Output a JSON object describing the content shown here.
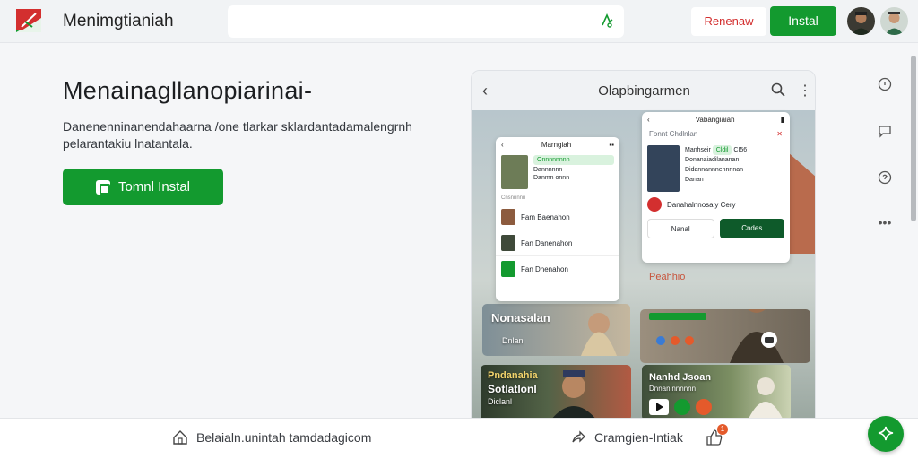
{
  "header": {
    "brand": "Menimgtianiah",
    "search_placeholder": "",
    "signin_label": "Renenaw",
    "install_label": "Instal"
  },
  "hero": {
    "title": "Menainagllanopiarinai-",
    "description": "Danenenninanendahaarna /one tlarkar sklardantadamalengrnh pelarantakiu lnatantala.",
    "button_label": "Tomnl Instal"
  },
  "preview": {
    "title": "Olapbingarmen",
    "left_card": {
      "header": "Marngiah",
      "featured_line1": "Onnnnnnnn",
      "featured_line2": "Dannnnnn",
      "featured_line3": "Danmn  onnn",
      "section_label": "Cnsnnnnn",
      "rows": [
        "Fam Baenahon",
        "Fan Danenahon",
        "Fan Dnenahon"
      ]
    },
    "right_card": {
      "header": "Vabangiaiah",
      "subtitle": "Fonnt Chdlnlan",
      "profile_name": "Manhseir",
      "profile_tag": "Cldil",
      "profile_meta": "CI56",
      "profile_line1": "Donanaiadilananan",
      "profile_line2": "Didannannnennnnan",
      "profile_line3": "Danan",
      "notice": "Danahalnnosaiy Cery",
      "secondary_button": "Nanal",
      "primary_button": "Cndes"
    },
    "tiles": {
      "left_top": "Nonasalan",
      "left_top_sub": "Dnlan",
      "left_bottom_line1": "Pndanahia",
      "left_bottom_line2": "Sotlatlonl",
      "left_bottom_line3": "Diclanl",
      "right_mid_label": "Peahhio",
      "right_bottom_line1": "Nanhd Jsoan",
      "right_bottom_line2": "Dnnaninnnnnn"
    }
  },
  "bottom": {
    "left_label": "Belaialn.unintah tamdadagicom",
    "right_label": "Cramgien-Intiak",
    "badge_count": "1"
  },
  "colors": {
    "accent": "#139a2f",
    "danger": "#d32f2f",
    "badge": "#e45a2b"
  }
}
